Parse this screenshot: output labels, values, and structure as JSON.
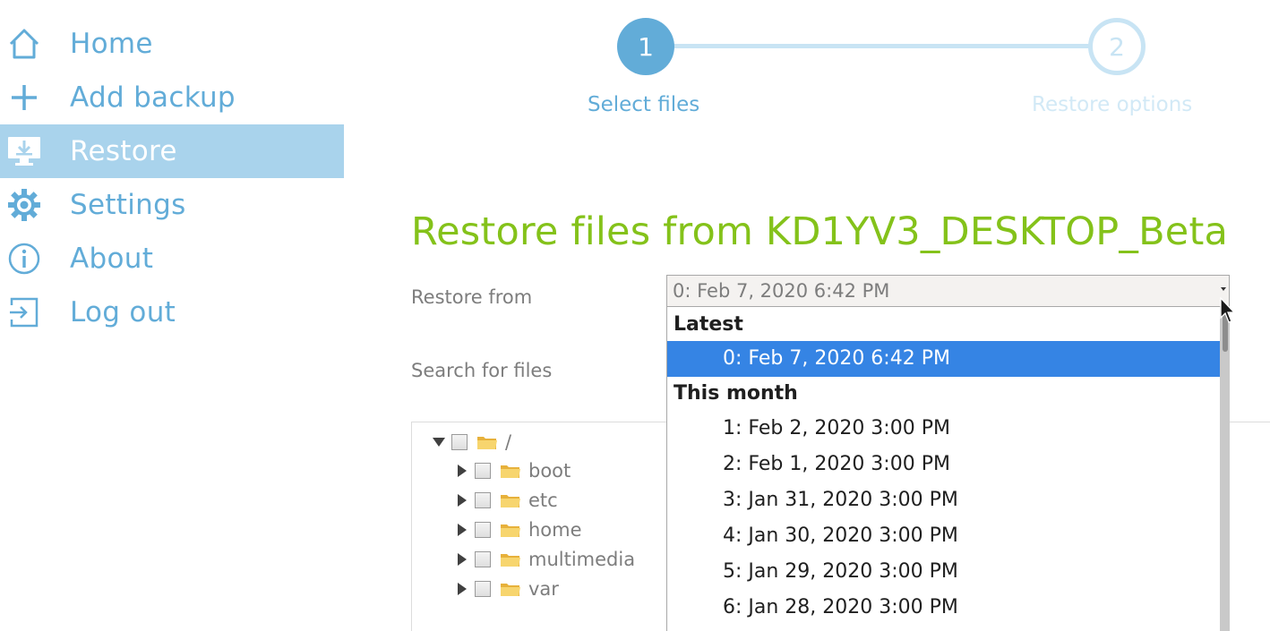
{
  "sidebar": {
    "items": [
      {
        "label": "Home",
        "icon": "home-icon"
      },
      {
        "label": "Add backup",
        "icon": "plus-icon"
      },
      {
        "label": "Restore",
        "icon": "restore-icon",
        "active": true
      },
      {
        "label": "Settings",
        "icon": "gear-icon"
      },
      {
        "label": "About",
        "icon": "info-icon"
      },
      {
        "label": "Log out",
        "icon": "logout-icon"
      }
    ]
  },
  "stepper": {
    "steps": [
      {
        "number": "1",
        "label": "Select files",
        "active": true
      },
      {
        "number": "2",
        "label": "Restore options",
        "active": false
      }
    ]
  },
  "main": {
    "title": "Restore files from KD1YV3_DESKTOP_Beta",
    "restore_from_label": "Restore from",
    "search_label": "Search for files",
    "select": {
      "selected_value": "0: Feb 7, 2020 6:42 PM"
    },
    "dropdown": {
      "groups": [
        {
          "label": "Latest",
          "options": [
            "0: Feb 7, 2020 6:42 PM"
          ]
        },
        {
          "label": "This month",
          "options": [
            "1: Feb 2, 2020 3:00 PM",
            "2: Feb 1, 2020 3:00 PM",
            "3: Jan 31, 2020 3:00 PM",
            "4: Jan 30, 2020 3:00 PM",
            "5: Jan 29, 2020 3:00 PM",
            "6: Jan 28, 2020 3:00 PM"
          ]
        }
      ]
    },
    "tree": {
      "root": "/",
      "children": [
        "boot",
        "etc",
        "home",
        "multimedia",
        "var"
      ]
    }
  },
  "colors": {
    "accent_blue": "#62acd8",
    "active_nav_bg": "#a9d3ec",
    "title_green": "#84c21a",
    "selected_option_bg": "#3584e4",
    "folder_yellow": "#f2c14e"
  }
}
